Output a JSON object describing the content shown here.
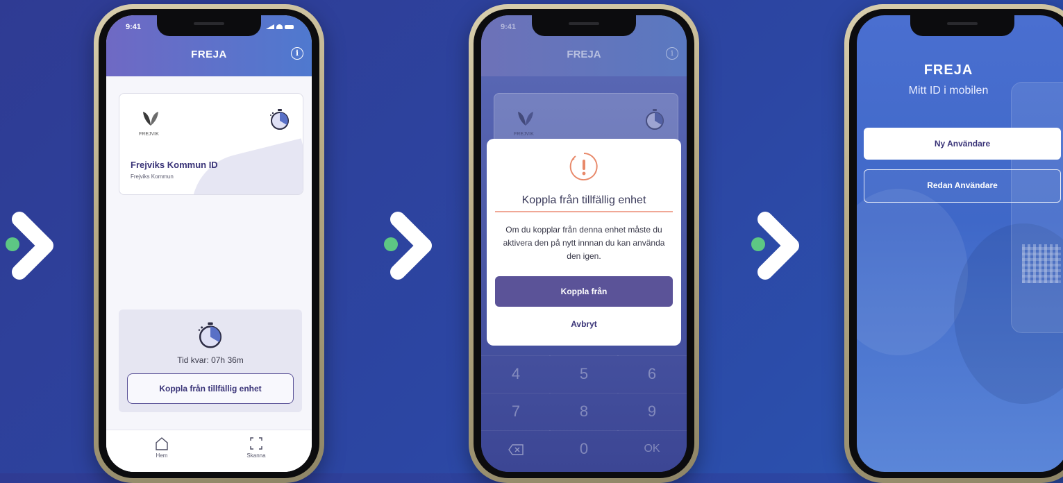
{
  "colors": {
    "accent": "#5b5398",
    "brand_gradient_start": "#6f69c4",
    "brand_gradient_end": "#4f79cf",
    "arrow": "#ffffff",
    "dot": "#5dc784",
    "alert": "#e8896a"
  },
  "screen1": {
    "status_time": "9:41",
    "app_title": "FREJA",
    "card": {
      "logo_text": "FREJVIK",
      "title": "Frejviks Kommun ID",
      "subtitle": "Frejviks Kommun"
    },
    "time_left": "Tid kvar: 07h 36m",
    "disconnect_label": "Koppla från tillfällig enhet",
    "tabs": [
      {
        "label": "Hem",
        "icon": "home-icon"
      },
      {
        "label": "Skanna",
        "icon": "scan-icon"
      }
    ]
  },
  "screen2": {
    "status_time": "9:41",
    "app_title": "FREJA",
    "card_logo_text": "FREJVIK",
    "modal": {
      "title": "Koppla från tillfällig enhet",
      "body": "Om du kopplar från denna enhet måste du aktivera den på nytt innnan du kan använda den igen.",
      "confirm": "Koppla från",
      "cancel": "Avbryt"
    },
    "keypad": [
      "4",
      "5",
      "6",
      "7",
      "8",
      "9",
      "0",
      "OK"
    ]
  },
  "screen3": {
    "brand": "FREJA",
    "tagline": "Mitt ID i mobilen",
    "new_user": "Ny Användare",
    "existing_user": "Redan Användare"
  }
}
